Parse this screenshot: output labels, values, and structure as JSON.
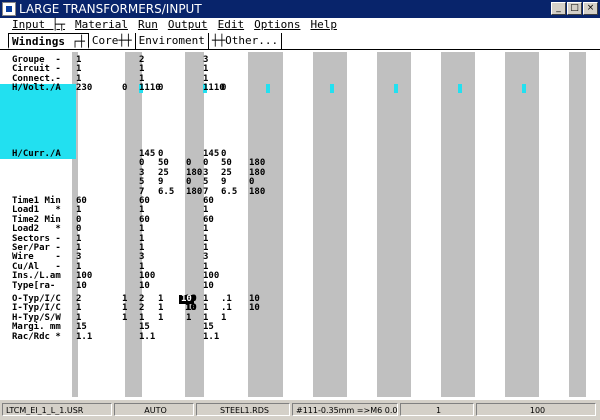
{
  "window": {
    "title": "LARGE TRANSFORMERS/INPUT",
    "btn_min": "_",
    "btn_restore": "□",
    "btn_close": "×"
  },
  "menu": [
    "Input ├┬",
    "Material",
    "Run",
    "Output",
    "Edit",
    "Options",
    "Help"
  ],
  "tabs": [
    "Windings ┌┼",
    "Core┼┼",
    "Enviroment",
    "┼┼Other..."
  ],
  "labels": [
    "Groupe  -",
    "Circuit -",
    "Connect.-",
    "H/Volt./A",
    "",
    "",
    "",
    "",
    "",
    "",
    "H/Curr./A",
    "",
    "",
    "",
    "",
    "Time1 Min",
    "Load1   *",
    "Time2 Min",
    "Load2   *",
    "Sectors -",
    "Ser/Par -",
    "Wire    -",
    "Cu/Al   -",
    "Ins./L.am",
    "Type[ra-",
    "O-Typ/I/C",
    "I-Typ/I/C",
    "H-Typ/S/W",
    "Margi. mm",
    "Rac/Rdc *"
  ],
  "col1": [
    "1",
    "1",
    "1",
    "230",
    "",
    "",
    "",
    "",
    "",
    "",
    "",
    "",
    "",
    "",
    "",
    "60",
    "1",
    "0",
    "0",
    "1",
    "1",
    "3",
    "1",
    "100",
    "10",
    "2",
    "1",
    "1",
    "15",
    "1.1"
  ],
  "col1b": [
    "",
    "",
    "",
    "0",
    "",
    "",
    "",
    "",
    "",
    "",
    "",
    "",
    "",
    "",
    "",
    "",
    "",
    "",
    "",
    "",
    "",
    "",
    "",
    "",
    "",
    "1",
    "1",
    "1",
    "",
    ""
  ],
  "col1c": [
    "",
    "",
    "",
    "",
    "",
    "",
    "",
    "",
    "",
    "",
    "",
    "",
    "",
    "",
    "",
    "",
    "",
    "",
    "",
    "",
    "",
    "",
    "",
    "",
    "",
    "10",
    "10",
    "",
    "",
    ""
  ],
  "col2": [
    "2",
    "1",
    "1",
    "1110",
    "",
    "",
    "",
    "",
    "",
    "",
    "145",
    "0",
    "3",
    "5",
    "7",
    "60",
    "1",
    "60",
    "1",
    "1",
    "1",
    "3",
    "1",
    "100",
    "10",
    "2",
    "2",
    "1",
    "15",
    "1.1"
  ],
  "col2b": [
    "",
    "",
    "",
    "0",
    "",
    "",
    "",
    "",
    "",
    "",
    "0",
    "50",
    "25",
    "9",
    "6.5",
    "",
    "",
    "",
    "",
    "",
    "",
    "",
    "",
    "",
    "",
    "1",
    "1",
    "1",
    "",
    ""
  ],
  "col2c": [
    "",
    "",
    "",
    "",
    "",
    "",
    "",
    "",
    "",
    "",
    "",
    "0",
    "180",
    "0",
    "180",
    "",
    "",
    "",
    "",
    "",
    "",
    "",
    "",
    "",
    "",
    "10",
    "10",
    "1",
    "",
    ""
  ],
  "col3": [
    "3",
    "1",
    "1",
    "1110",
    "",
    "",
    "",
    "",
    "",
    "",
    "145",
    "0",
    "3",
    "5",
    "7",
    "60",
    "1",
    "60",
    "1",
    "1",
    "1",
    "3",
    "1",
    "100",
    "10",
    "1",
    "1",
    "1",
    "15",
    "1.1"
  ],
  "col3b": [
    "",
    "",
    "",
    "0",
    "",
    "",
    "",
    "",
    "",
    "",
    "0",
    "50",
    "25",
    "9",
    "6.5",
    "",
    "",
    "",
    "",
    "",
    "",
    "",
    "",
    "",
    "",
    ".1",
    ".1",
    "1",
    "",
    ""
  ],
  "col3c": [
    "",
    "",
    "",
    "",
    "",
    "",
    "",
    "",
    "",
    "",
    "",
    "180",
    "180",
    "0",
    "180",
    "",
    "",
    "",
    "",
    "",
    "",
    "",
    "",
    "",
    "",
    "10",
    "10",
    "",
    "",
    ""
  ],
  "selected_cell": "10",
  "status": [
    "LTCM_EI_1_L_1.USR",
    "AUTO",
    "STEEL1.RDS",
    "#111-0.35mm =>M6 0.014'",
    "1",
    "100"
  ]
}
